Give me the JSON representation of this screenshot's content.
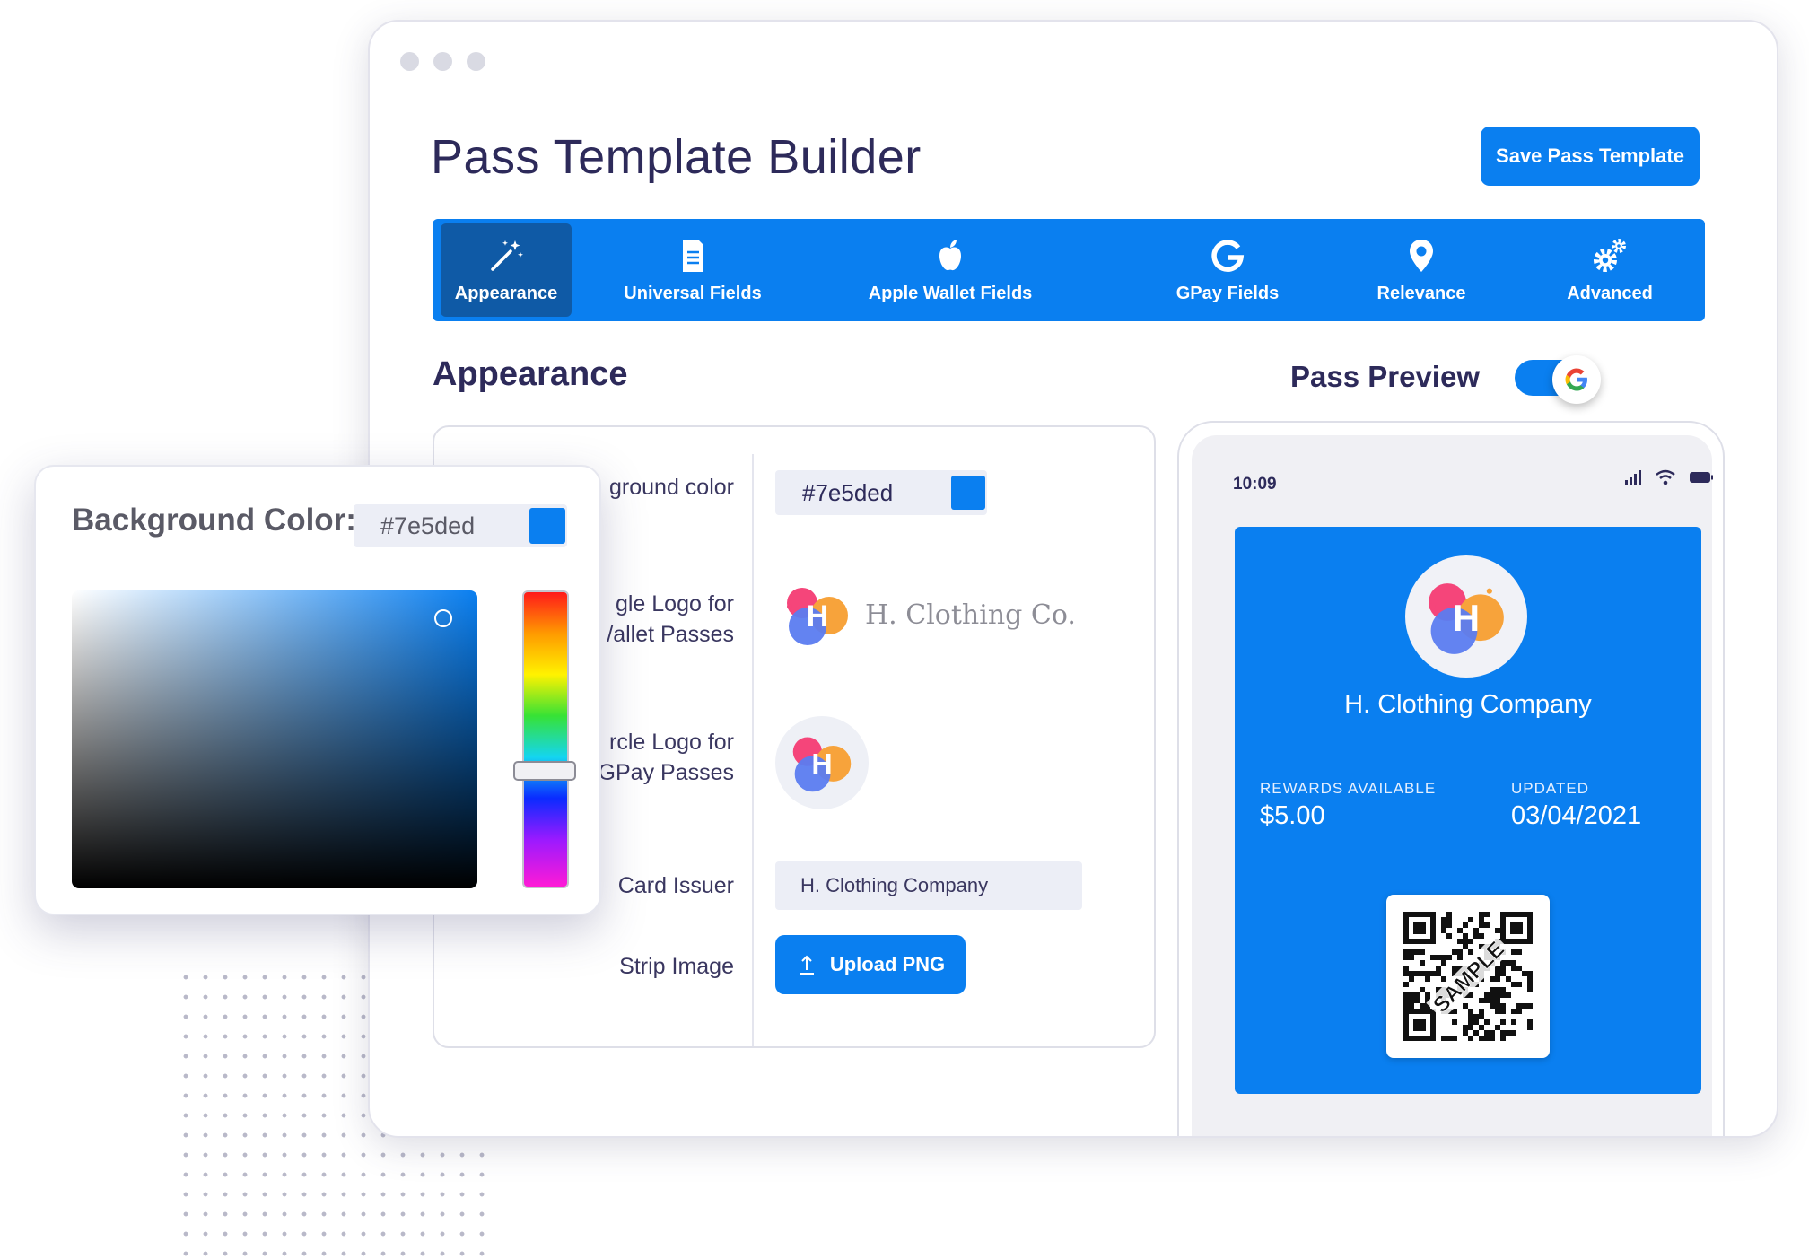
{
  "header": {
    "title": "Pass Template Builder",
    "save_label": "Save Pass Template"
  },
  "tabs": [
    {
      "label": "Appearance",
      "icon": "magic-wand-icon",
      "active": true
    },
    {
      "label": "Universal Fields",
      "icon": "document-icon"
    },
    {
      "label": "Apple Wallet Fields",
      "icon": "apple-icon"
    },
    {
      "label": "GPay Fields",
      "icon": "google-g-icon"
    },
    {
      "label": "Relevance",
      "icon": "location-pin-icon"
    },
    {
      "label": "Advanced",
      "icon": "gears-icon"
    }
  ],
  "appearance": {
    "title": "Appearance",
    "rows": {
      "background_color": {
        "label": "ground color",
        "value": "#7e5ded"
      },
      "rect_logo": {
        "label_line1": "gle Logo for",
        "label_line2": "/allet Passes",
        "brand": "H. Clothing Co."
      },
      "circle_logo": {
        "label_line1": "rcle Logo for",
        "label_line2": "GPay Passes"
      },
      "card_issuer": {
        "label": "Card Issuer",
        "value": "H. Clothing Company"
      },
      "strip_image": {
        "label": "Strip Image",
        "button": "Upload PNG"
      }
    }
  },
  "preview": {
    "title": "Pass Preview",
    "time": "10:09",
    "card": {
      "logo_letter": "H",
      "company": "H. Clothing Company",
      "rewards_label": "REWARDS AVAILABLE",
      "rewards_value": "$5.00",
      "updated_label": "UPDATED",
      "updated_value": "03/04/2021",
      "qr_stamp": "SAMPLE"
    }
  },
  "color_picker": {
    "title": "Background Color:",
    "hex": "#7e5ded"
  },
  "colors": {
    "accent": "#0a7ff0",
    "active_tab": "#0f5aa6",
    "text_dark": "#2d2a5a"
  }
}
